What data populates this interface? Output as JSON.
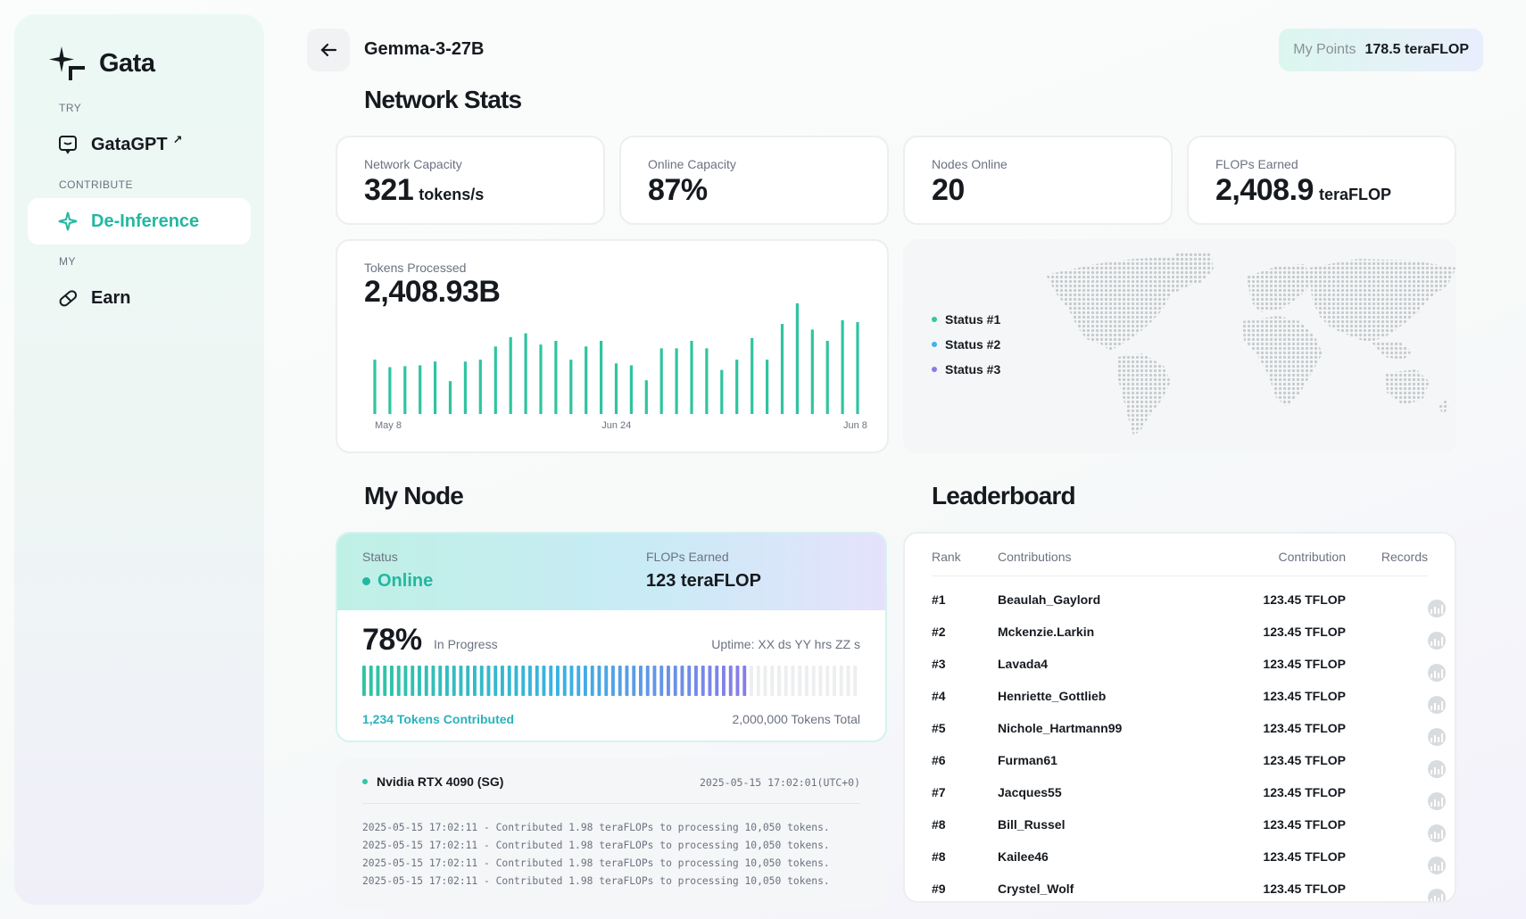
{
  "sidebar": {
    "brand": "Gata",
    "sections": [
      {
        "label": "TRY",
        "item": {
          "label": "GataGPT",
          "icon": "chat-icon",
          "external": "↗"
        }
      },
      {
        "label": "CONTRIBUTE",
        "item": {
          "label": "De-Inference",
          "icon": "sparkle-icon"
        }
      },
      {
        "label": "MY",
        "item": {
          "label": "Earn",
          "icon": "pill-icon"
        }
      }
    ]
  },
  "header": {
    "model": "Gemma-3-27B",
    "points_label": "My Points",
    "points_value": "178.5 teraFLOP"
  },
  "network": {
    "title": "Network Stats",
    "stats": [
      {
        "label": "Network Capacity",
        "value": "321",
        "unit": "tokens/s"
      },
      {
        "label": "Online Capacity",
        "value": "87%",
        "unit": ""
      },
      {
        "label": "Nodes Online",
        "value": "20",
        "unit": ""
      },
      {
        "label": "FLOPs Earned",
        "value": "2,408.9",
        "unit": "teraFLOP"
      }
    ],
    "tokens_label": "Tokens Processed",
    "tokens_value": "2,408.93B",
    "map_legend": [
      "Status #1",
      "Status #2",
      "Status #3"
    ],
    "legend_colors": [
      "#2fc8a2",
      "#3fb4e6",
      "#8a7ae8"
    ]
  },
  "chart_data": {
    "type": "bar",
    "x_tick_labels": [
      "May 8",
      "Jun 24",
      "Jun 8"
    ],
    "values": [
      58,
      50,
      51,
      52,
      56,
      35,
      56,
      58,
      72,
      82,
      86,
      74,
      78,
      58,
      72,
      78,
      54,
      52,
      36,
      70,
      70,
      78,
      70,
      47,
      58,
      81,
      58,
      96,
      118,
      90,
      78,
      100,
      98
    ],
    "color": "#2fc4a0"
  },
  "node": {
    "title": "My Node",
    "status_label": "Status",
    "status_value": "Online",
    "flops_label": "FLOPs Earned",
    "flops_value": "123 teraFLOP",
    "progress_pct": "78%",
    "progress_fraction": 0.78,
    "progress_sub": "In Progress",
    "uptime": "Uptime: XX ds YY hrs ZZ s",
    "contributed": "1,234 Tokens Contributed",
    "total": "2,000,000 Tokens Total"
  },
  "log": {
    "device": "Nvidia RTX 4090 (SG)",
    "timestamp": "2025-05-15 17:02:01(UTC+0)",
    "lines": [
      "2025-05-15 17:02:11 - Contributed 1.98 teraFLOPs to processing 10,050 tokens.",
      "2025-05-15 17:02:11 - Contributed 1.98 teraFLOPs to processing 10,050 tokens.",
      "2025-05-15 17:02:11 - Contributed 1.98 teraFLOPs to processing 10,050 tokens.",
      "2025-05-15 17:02:11 - Contributed 1.98 teraFLOPs to processing 10,050 tokens."
    ]
  },
  "leaderboard": {
    "title": "Leaderboard",
    "columns": [
      "Rank",
      "Contributions",
      "Contribution",
      "Records"
    ],
    "rows": [
      {
        "rank": "#1",
        "name": "Beaulah_Gaylord",
        "value": "123.45 TFLOP"
      },
      {
        "rank": "#2",
        "name": "Mckenzie.Larkin",
        "value": "123.45 TFLOP"
      },
      {
        "rank": "#3",
        "name": "Lavada4",
        "value": "123.45 TFLOP"
      },
      {
        "rank": "#4",
        "name": "Henriette_Gottlieb",
        "value": "123.45 TFLOP"
      },
      {
        "rank": "#5",
        "name": "Nichole_Hartmann99",
        "value": "123.45 TFLOP"
      },
      {
        "rank": "#6",
        "name": "Furman61",
        "value": "123.45 TFLOP"
      },
      {
        "rank": "#7",
        "name": "Jacques55",
        "value": "123.45 TFLOP"
      },
      {
        "rank": "#8",
        "name": "Bill_Russel",
        "value": "123.45 TFLOP"
      },
      {
        "rank": "#8",
        "name": "Kailee46",
        "value": "123.45 TFLOP"
      },
      {
        "rank": "#9",
        "name": "Crystel_Wolf",
        "value": "123.45 TFLOP"
      }
    ]
  }
}
